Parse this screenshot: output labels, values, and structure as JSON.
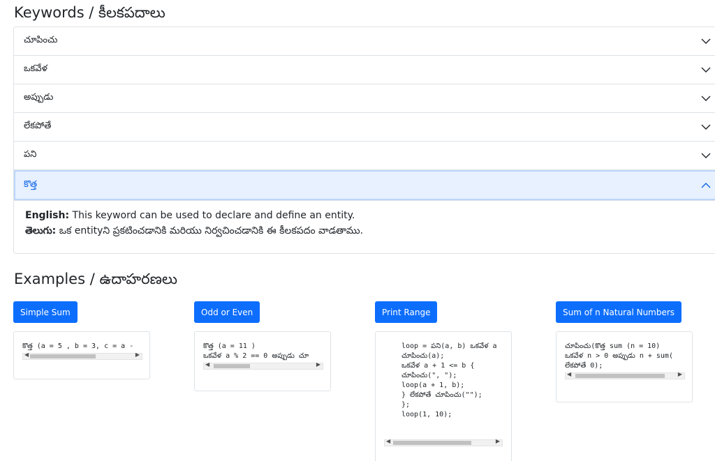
{
  "keywords": {
    "title": "Keywords / కీలకపదాలు",
    "items": [
      {
        "label": "చూపించు",
        "expanded": false
      },
      {
        "label": "ఒకవేళ",
        "expanded": false
      },
      {
        "label": "అప్పుడు",
        "expanded": false
      },
      {
        "label": "లేకపోతే",
        "expanded": false
      },
      {
        "label": "పని",
        "expanded": false
      },
      {
        "label": "కొత్త",
        "expanded": true
      }
    ],
    "expanded_body": {
      "english_label": "English:",
      "english_text": " This keyword can be used to declare and define an entity.",
      "telugu_label": "తెలుగు:",
      "telugu_text": " ఒక entityని ప్రకటించడానికి మరియు నిర్వచించడానికి ఈ కీలకపదం వాడతాము."
    }
  },
  "examples": {
    "title": "Examples / ఉదాహరణలు",
    "items": [
      {
        "button": "Simple Sum",
        "code": "కొత్త (a = 5 , b = 3, c = a -"
      },
      {
        "button": "Odd or Even",
        "code": "కొత్త (a = 11 )\nఒకవేళ a % 2 == 0 అప్పుడు చూ"
      },
      {
        "button": "Print Range",
        "code": "loop = పని(a, b) ఒకవేళ a\nచూపించు(a);\nఒకవేళ a + 1 <= b {\nచూపించు(\", \");\nloop(a + 1, b);\n} లేకపోతే చూపించు(\"\");\n};\nloop(1, 10);"
      },
      {
        "button": "Sum of n Natural Numbers",
        "code": "చూపించు(కొత్త sum (n = 10)\nఒకవేళ n > 0 అప్పుడు n + sum(\nలేకపోతే 0);"
      }
    ]
  },
  "colors": {
    "primary": "#0d6efd",
    "active_bg": "#e7f1ff",
    "active_text": "#0c63e4"
  }
}
